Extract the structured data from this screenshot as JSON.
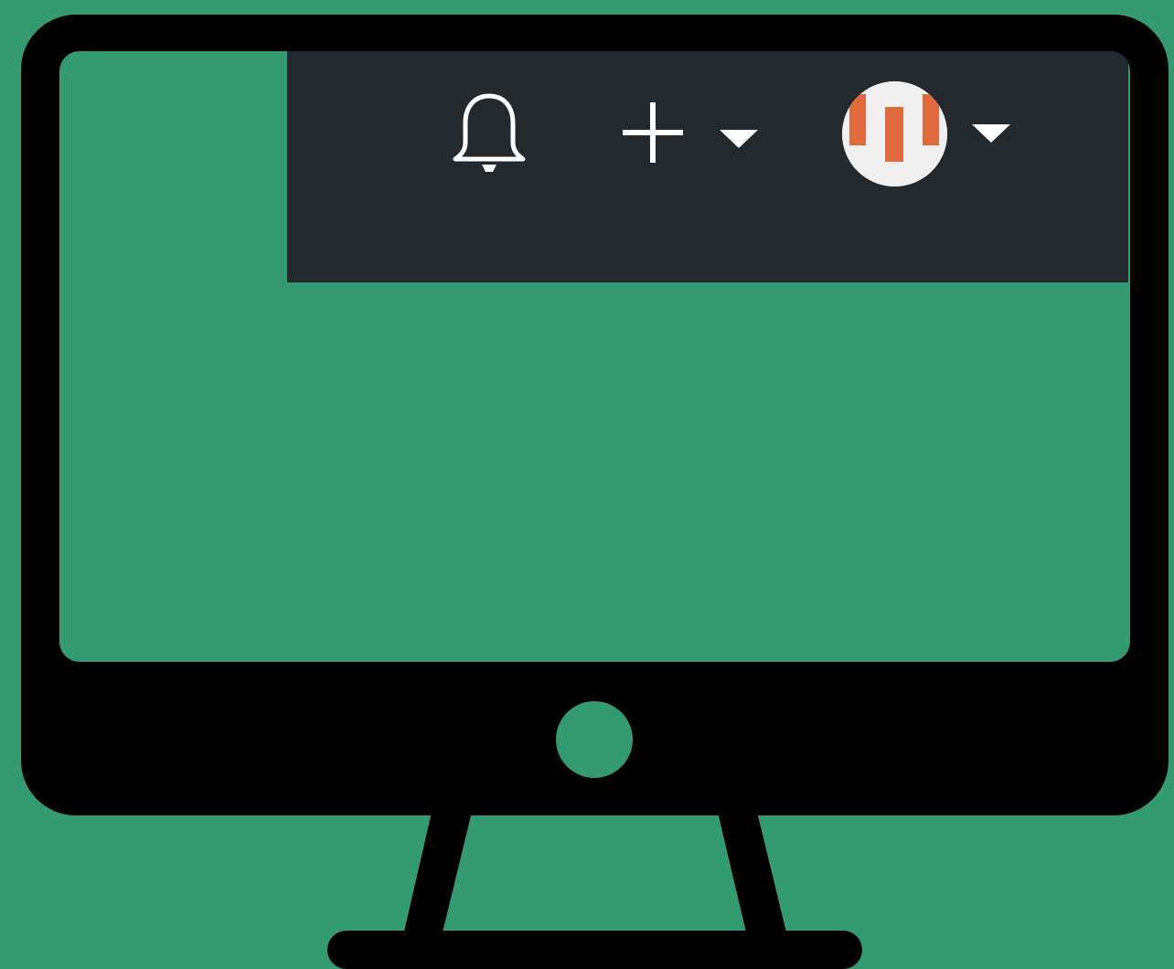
{
  "scene": {
    "description_name": "monitor-illustration",
    "background_color": "#339a71",
    "monitor_color": "#000000"
  },
  "toolbar": {
    "background_color": "#24292e",
    "icon_color": "#ffffff",
    "items": [
      {
        "name": "notifications",
        "icon": "bell-icon"
      },
      {
        "name": "create-new",
        "icon": "plus-icon"
      },
      {
        "name": "create-new-menu",
        "icon": "caret-down-icon"
      },
      {
        "name": "user-avatar",
        "icon": "avatar-identicon"
      },
      {
        "name": "user-menu",
        "icon": "caret-down-icon"
      }
    ]
  },
  "avatar": {
    "background_color": "#f0f0f0",
    "accent_color": "#e06a3c"
  }
}
